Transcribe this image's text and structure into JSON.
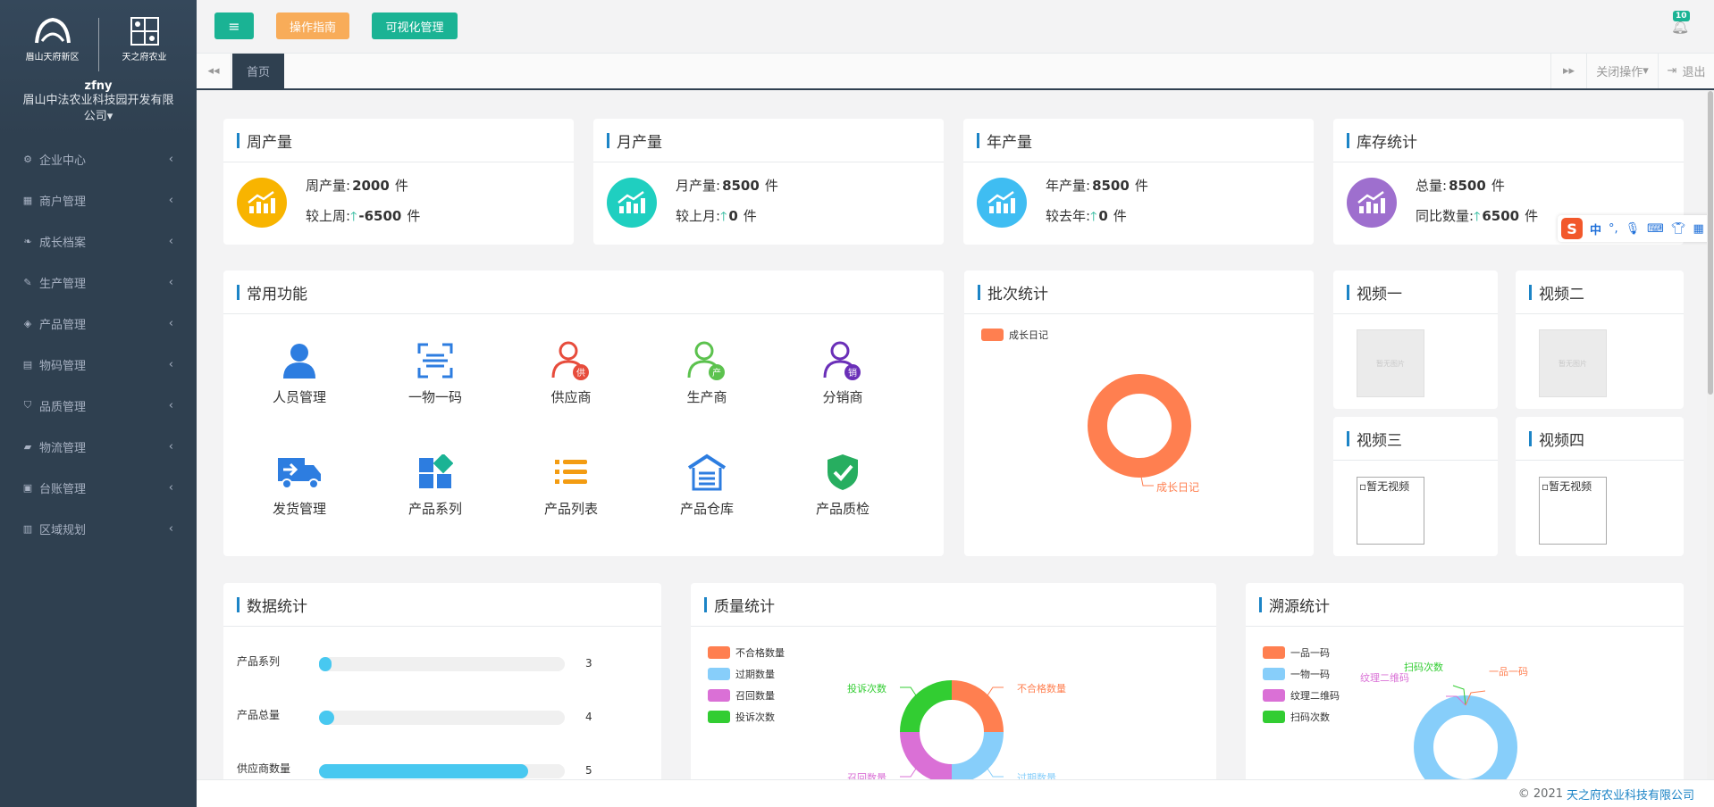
{
  "sidebar": {
    "logo_left_caption": "眉山天府新区",
    "logo_right_caption": "天之府农业",
    "user_name": "zfny",
    "company": "眉山中法农业科技园开发有限公司",
    "menu": [
      {
        "label": "企业中心",
        "icon": "gear-icon"
      },
      {
        "label": "商户管理",
        "icon": "table-icon"
      },
      {
        "label": "成长档案",
        "icon": "leaf-icon"
      },
      {
        "label": "生产管理",
        "icon": "wrench-icon"
      },
      {
        "label": "产品管理",
        "icon": "cube-icon"
      },
      {
        "label": "物码管理",
        "icon": "book-icon"
      },
      {
        "label": "品质管理",
        "icon": "shield-icon"
      },
      {
        "label": "物流管理",
        "icon": "truck-icon"
      },
      {
        "label": "台账管理",
        "icon": "ledger-icon"
      },
      {
        "label": "区域规划",
        "icon": "map-icon"
      }
    ]
  },
  "topbar": {
    "guide_button": "操作指南",
    "visual_button": "可视化管理",
    "notification_count": "10"
  },
  "tabs": {
    "home": "首页",
    "close_ops": "关闭操作",
    "logout": "退出"
  },
  "stats": [
    {
      "title": "周产量",
      "line1_label": "周产量:",
      "line1_value": "2000",
      "line1_unit": "件",
      "line2_label": "较上周:",
      "line2_value": "-6500",
      "line2_unit": "件",
      "color": "#f8b400"
    },
    {
      "title": "月产量",
      "line1_label": "月产量:",
      "line1_value": "8500",
      "line1_unit": "件",
      "line2_label": "较上月:",
      "line2_value": "0",
      "line2_unit": "件",
      "color": "#1fcfc0"
    },
    {
      "title": "年产量",
      "line1_label": "年产量:",
      "line1_value": "8500",
      "line1_unit": "件",
      "line2_label": "较去年:",
      "line2_value": "0",
      "line2_unit": "件",
      "color": "#3fbdf2"
    },
    {
      "title": "库存统计",
      "line1_label": "总量:",
      "line1_value": "8500",
      "line1_unit": "件",
      "line2_label": "同比数量:",
      "line2_value": "6500",
      "line2_unit": "件",
      "color": "#9e6fce"
    }
  ],
  "common": {
    "title": "常用功能",
    "items": [
      {
        "label": "人员管理",
        "icon": "person-icon"
      },
      {
        "label": "一物一码",
        "icon": "scan-code-icon"
      },
      {
        "label": "供应商",
        "icon": "supplier-icon"
      },
      {
        "label": "生产商",
        "icon": "producer-icon"
      },
      {
        "label": "分销商",
        "icon": "distributor-icon"
      },
      {
        "label": "发货管理",
        "icon": "delivery-truck-icon"
      },
      {
        "label": "产品系列",
        "icon": "grid-blocks-icon"
      },
      {
        "label": "产品列表",
        "icon": "list-icon"
      },
      {
        "label": "产品仓库",
        "icon": "warehouse-icon"
      },
      {
        "label": "产品质检",
        "icon": "check-shield-icon"
      }
    ]
  },
  "batch": {
    "title": "批次统计",
    "legend": "成长日记",
    "slice_label": "成长日记",
    "color": "#ff7f50"
  },
  "videos": {
    "v1": "视频一",
    "v2": "视频二",
    "v3": "视频三",
    "v4": "视频四",
    "thumb_caption": "暂无图片",
    "no_video": "暂无视频"
  },
  "data_stats": {
    "title": "数据统计",
    "rows": [
      {
        "label": "产品系列",
        "value": "3",
        "fill": 0.05
      },
      {
        "label": "产品总量",
        "value": "4",
        "fill": 0.06
      },
      {
        "label": "供应商数量",
        "value": "5",
        "fill": 0.85
      }
    ]
  },
  "quality": {
    "title": "质量统计",
    "legend": [
      {
        "label": "不合格数量",
        "color": "#ff7f50"
      },
      {
        "label": "过期数量",
        "color": "#87cefa"
      },
      {
        "label": "召回数量",
        "color": "#da70d6"
      },
      {
        "label": "投诉次数",
        "color": "#32cd32"
      }
    ],
    "labels": {
      "unqualified": "不合格数量",
      "expired": "过期数量",
      "recall": "召回数量",
      "complaint": "投诉次数"
    }
  },
  "trace": {
    "title": "溯源统计",
    "legend": [
      {
        "label": "一品一码",
        "color": "#ff7f50"
      },
      {
        "label": "一物一码",
        "color": "#87cefa"
      },
      {
        "label": "纹理二维码",
        "color": "#da70d6"
      },
      {
        "label": "扫码次数",
        "color": "#32cd32"
      }
    ],
    "labels": {
      "scan": "扫码次数",
      "texture": "纹理二维码",
      "yipin": "一品一码"
    }
  },
  "ime": {
    "label": "中"
  },
  "footer": {
    "copyright": "© 2021",
    "company_link": "天之府农业科技有限公司"
  }
}
